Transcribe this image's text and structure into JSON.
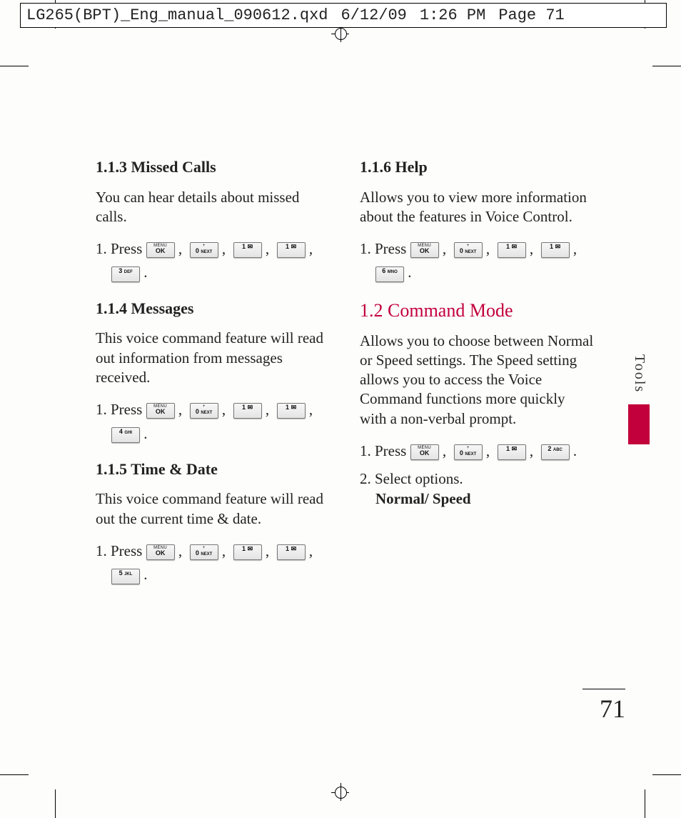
{
  "header": {
    "filename": "LG265(BPT)_Eng_manual_090612.qxd",
    "date": "6/12/09",
    "time": "1:26 PM",
    "page_label": "Page 71"
  },
  "keys": {
    "menu_top": "MENU",
    "menu_bottom": "OK",
    "k0_main": "0",
    "k0_sub": "NEXT",
    "k0_plus": "+",
    "k1_main": "1",
    "k1_sub": "✉",
    "k2_main": "2",
    "k2_sub": "ABC",
    "k3_main": "3",
    "k3_sub": "DEF",
    "k4_main": "4",
    "k4_sub": "GHI",
    "k5_main": "5",
    "k5_sub": "JKL",
    "k6_main": "6",
    "k6_sub": "MNO"
  },
  "left": {
    "h113": "1.1.3 Missed Calls",
    "p113": "You can hear details about missed calls.",
    "s113": "1. Press ",
    "h114": "1.1.4 Messages",
    "p114": "This voice command feature will read out information from messages received.",
    "s114": "1. Press ",
    "h115": "1.1.5 Time & Date",
    "p115": "This voice command feature will read out the current time & date.",
    "s115": "1. Press "
  },
  "right": {
    "h116": "1.1.6 Help",
    "p116": "Allows you to view more information about the features in Voice Control.",
    "s116": "1. Press ",
    "h12": "1.2 Command Mode",
    "p12": "Allows you to choose between Normal or Speed settings. The Speed setting allows you to access the Voice Command functions more quickly with a non-verbal prompt.",
    "s12a": "1. Press ",
    "s12b": "2. Select options.",
    "s12b_bold": "Normal/ Speed"
  },
  "side_tab": "Tools",
  "page_number": "71"
}
